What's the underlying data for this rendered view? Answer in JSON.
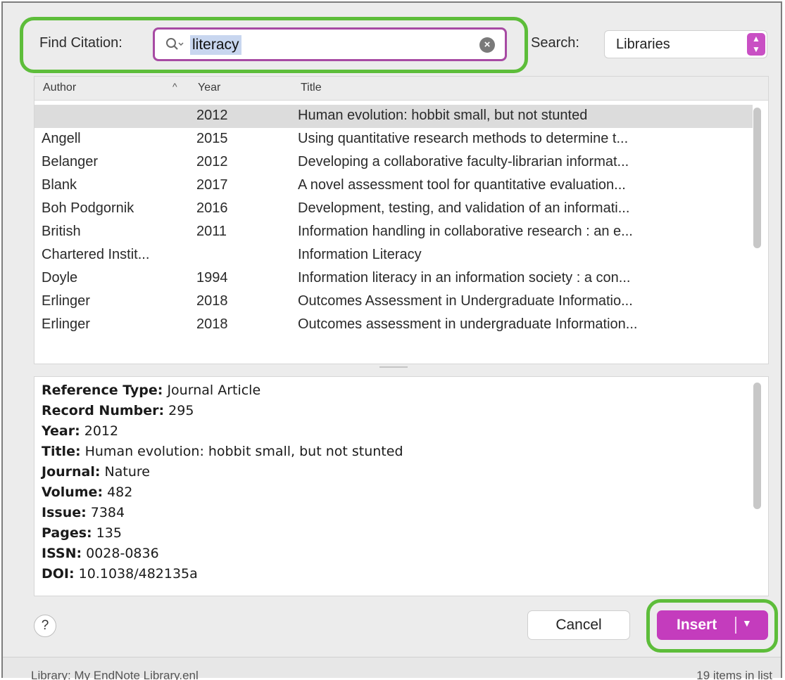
{
  "find": {
    "label": "Find Citation:",
    "query": "literacy"
  },
  "search_in": {
    "label": "Search:",
    "value": "Libraries"
  },
  "table": {
    "columns": {
      "author": "Author",
      "year": "Year",
      "title": "Title"
    },
    "rows": [
      {
        "author": "",
        "year": "2012",
        "title": "Human evolution: hobbit small, but not stunted"
      },
      {
        "author": "Angell",
        "year": "2015",
        "title": "Using quantitative research methods to determine t..."
      },
      {
        "author": "Belanger",
        "year": "2012",
        "title": "Developing a collaborative faculty-librarian informat..."
      },
      {
        "author": "Blank",
        "year": "2017",
        "title": "A novel assessment tool for quantitative evaluation..."
      },
      {
        "author": "Boh Podgornik",
        "year": "2016",
        "title": "Development, testing, and validation of an informati..."
      },
      {
        "author": "British",
        "year": "2011",
        "title": "Information handling in collaborative research : an e..."
      },
      {
        "author": "Chartered Instit...",
        "year": "",
        "title": "Information Literacy"
      },
      {
        "author": "Doyle",
        "year": "1994",
        "title": "Information literacy in an information society : a con..."
      },
      {
        "author": "Erlinger",
        "year": "2018",
        "title": "Outcomes Assessment in Undergraduate Informatio..."
      },
      {
        "author": "Erlinger",
        "year": "2018",
        "title": "Outcomes assessment in undergraduate Information..."
      }
    ]
  },
  "preview": {
    "fields": [
      {
        "label": "Reference Type:",
        "value": " Journal Article"
      },
      {
        "label": "Record Number:",
        "value": " 295"
      },
      {
        "label": "Year:",
        "value": " 2012"
      },
      {
        "label": "Title:",
        "value": " Human evolution: hobbit small, but not stunted"
      },
      {
        "label": "Journal:",
        "value": " Nature"
      },
      {
        "label": "Volume:",
        "value": " 482"
      },
      {
        "label": "Issue:",
        "value": " 7384"
      },
      {
        "label": "Pages:",
        "value": " 135"
      },
      {
        "label": "ISSN:",
        "value": " 0028-0836"
      },
      {
        "label": "DOI:",
        "value": " 10.1038/482135a"
      }
    ]
  },
  "buttons": {
    "help": "?",
    "cancel": "Cancel",
    "insert": "Insert"
  },
  "status": {
    "library": "Library: My EndNote Library.enl",
    "count": "19 items in list"
  },
  "colors": {
    "accent": "#c43cbd",
    "highlight_ring": "#5dbd3a",
    "search_border": "#a74aa3"
  },
  "icons": {
    "search": "magnifier-icon",
    "clear": "clear-icon",
    "sort": "sort-ascending-icon",
    "dropdown": "dropdown-arrow-icon"
  }
}
